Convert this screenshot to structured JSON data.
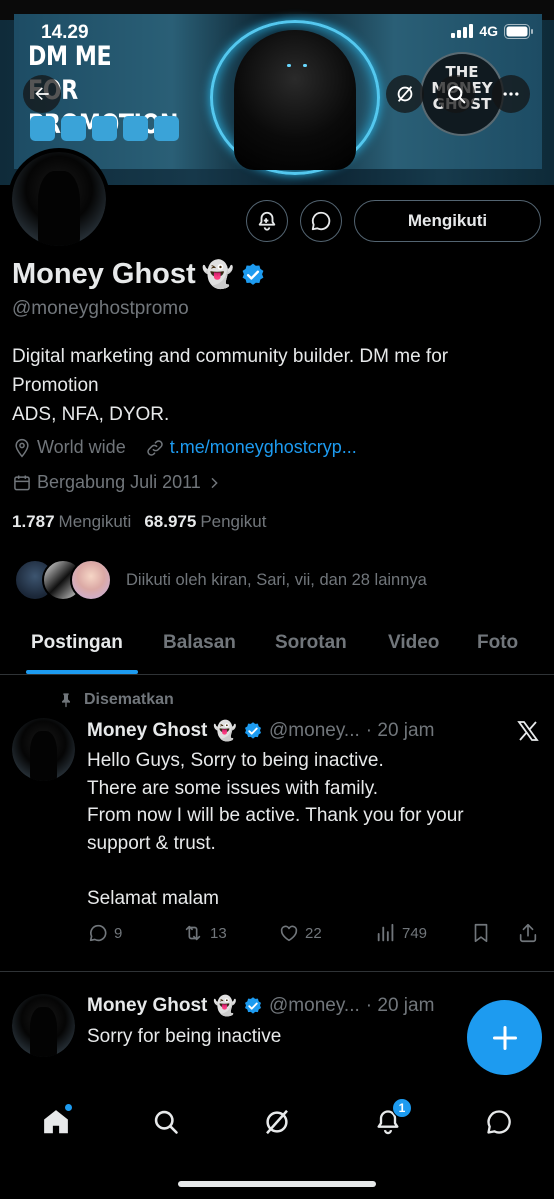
{
  "status_bar": {
    "time": "14.29",
    "network": "4G"
  },
  "banner": {
    "promo_line1": "DM ME FOR",
    "promo_line2": "PROMOTION",
    "logo_line1": "THE",
    "logo_line2": "MONEY",
    "logo_line3": "GHOST"
  },
  "profile": {
    "name": "Money Ghost",
    "emoji": "👻",
    "handle": "@moneyghostpromo",
    "follow_label": "Mengikuti",
    "bio_lines": [
      "Digital marketing and community builder. DM me for",
      "Promotion",
      "ADS, NFA, DYOR."
    ],
    "location": "World wide",
    "link": "t.me/moneyghostcryp...",
    "joined": "Bergabung Juli 2011",
    "following_count": "1.787",
    "following_label": "Mengikuti",
    "followers_count": "68.975",
    "followers_label": "Pengikut",
    "followed_by": "Diikuti oleh kiran, Sari, vii, dan 28 lainnya"
  },
  "tabs": [
    "Postingan",
    "Balasan",
    "Sorotan",
    "Video",
    "Foto"
  ],
  "posts": [
    {
      "pinned_label": "Disematkan",
      "author": "Money Ghost",
      "emoji": "👻",
      "handle": "@money...",
      "time": "· 20 jam",
      "lines": [
        "Hello Guys, Sorry to being inactive.",
        "There are some issues with family.",
        "From now I will be active. Thank you for your",
        "support & trust.",
        "",
        "Selamat malam"
      ],
      "replies": "9",
      "reposts": "13",
      "likes": "22",
      "views": "749"
    },
    {
      "author": "Money Ghost",
      "emoji": "👻",
      "handle": "@money...",
      "time": "· 20 jam",
      "lines": [
        "Sorry for being inactive"
      ]
    }
  ],
  "nav": {
    "notifications_badge": "1"
  },
  "colors": {
    "accent": "#1d9bf0",
    "background": "#000000",
    "muted": "#71767b",
    "text": "#e7e9ea",
    "divider": "#2f3336"
  },
  "icons": [
    "back-icon",
    "grok-icon",
    "search-icon",
    "more-icon",
    "bell-plus-icon",
    "message-icon",
    "verified-icon",
    "location-icon",
    "link-icon",
    "calendar-icon",
    "chevron-right-icon",
    "pin-icon",
    "x-logo-icon",
    "reply-icon",
    "repost-icon",
    "like-icon",
    "views-icon",
    "bookmark-icon",
    "share-icon",
    "plus-icon",
    "home-icon",
    "notifications-icon"
  ]
}
